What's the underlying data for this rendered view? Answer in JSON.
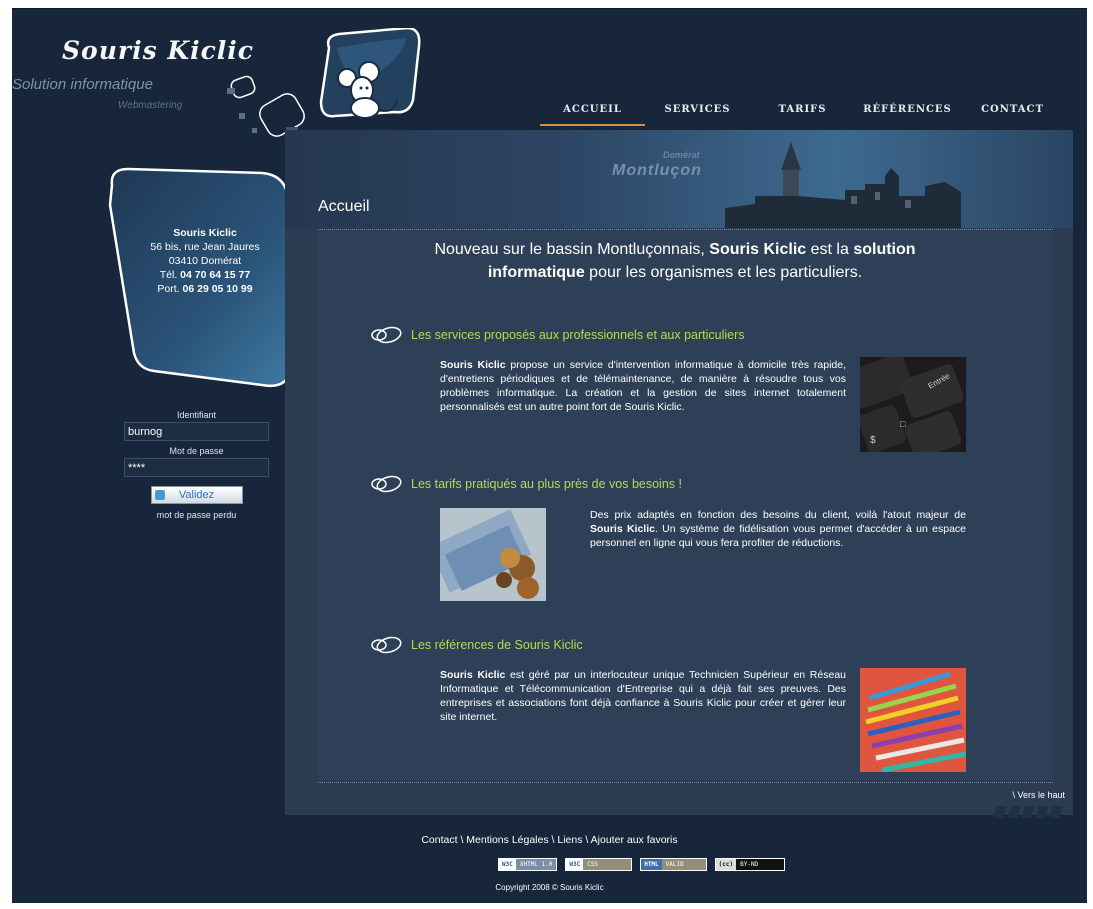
{
  "logo": {
    "title": "Souris Kiclic",
    "subtitle": "Solution informatique",
    "tagline": "Webmastering"
  },
  "nav": [
    {
      "label": "ACCUEIL",
      "active": true
    },
    {
      "label": "SERVICES"
    },
    {
      "label": "TARIFS"
    },
    {
      "label": "RÉFÉRENCES"
    },
    {
      "label": "CONTACT"
    }
  ],
  "contact_card": {
    "name": "Souris Kiclic",
    "address": "56 bis, rue Jean Jaures",
    "city": "03410 Domérat",
    "tel_label": "Tél.",
    "tel": "04 70 64 15 77",
    "port_label": "Port.",
    "port": "06 29 05 10 99"
  },
  "login": {
    "id_label": "Identifiant",
    "id_value": "burnog",
    "pwd_label": "Mot de passe",
    "pwd_value": "****",
    "submit": "Validez",
    "lost": "mot de passe perdu"
  },
  "banner": {
    "town_small": "Domérat",
    "town_big": "Montluçon"
  },
  "page_title": "Accueil",
  "intro": {
    "part1": "Nouveau sur le bassin Montluçonnais, ",
    "bold1": "Souris Kiclic",
    "part2": " est la ",
    "bold2": "solution informatique",
    "part3": " pour les organismes et les particuliers."
  },
  "sections": [
    {
      "title": "Les services proposés aux professionnels et aux particuliers",
      "bold": "Souris Kiclic",
      "text": " propose un service d'intervention informatique à domicile très rapide, d'entretiens périodiques et de télémaintenance, de manière à résoudre tous vos problèmes informatique. La création et la gestion de sites internet totalement personnalisés est un autre point fort de Souris Kiclic."
    },
    {
      "title": "Les tarifs pratiqués au plus près de vos besoins !",
      "text_before": "Des prix adaptés en fonction des besoins du client, voilà l'atout majeur de ",
      "bold": "Souris Kiclic",
      "text_after": ". Un système de fidélisation vous permet d'accéder à un espace personnel en ligne qui vous fera profiter de réductions."
    },
    {
      "title": "Les références de Souris Kiclic",
      "bold": "Souris Kiclic",
      "text": " est géré par un interlocuteur unique Technicien Supérieur en Réseau Informatique et Télécommunication d'Entreprise qui a déjà fait ses preuves. Des entreprises et associations font déjà confiance à Souris Kiclic pour créer et gérer leur site internet."
    }
  ],
  "top_link": "\\ Vers le haut",
  "footer": {
    "links": [
      "Contact",
      "Mentions Légales",
      "Liens",
      "Ajouter aux favoris"
    ],
    "separator": " \\ ",
    "badges": [
      {
        "left": "W3C",
        "right": "XHTML 1.0"
      },
      {
        "left": "W3C",
        "right": "CSS"
      },
      {
        "left": "HTML",
        "right": "VALID"
      },
      {
        "left": "(cc)",
        "right": "BY-ND"
      }
    ],
    "copyright": "Copyright 2008 © Souris Kiclic"
  },
  "colors": {
    "background": "#17263a",
    "panel": "#2b3c52",
    "accent_green": "#b3dc52",
    "nav_underline": "#d3913f"
  },
  "icons": [
    "mouse-logo-icon",
    "mouse-eye-icon",
    "keyboard-image",
    "money-image",
    "pencils-image"
  ]
}
